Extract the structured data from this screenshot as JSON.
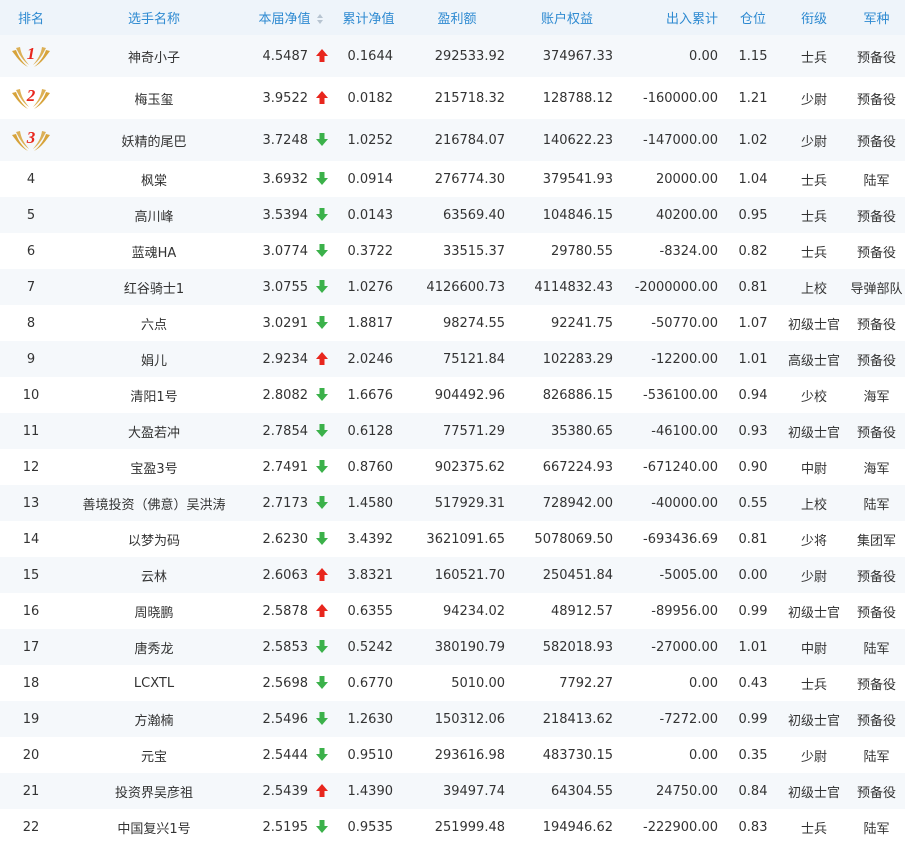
{
  "colors": {
    "header_text": "#2e8ad1",
    "header_bg": "#eef4fa",
    "up_arrow": "#e8261d",
    "down_arrow": "#3bb14a",
    "medal_number": "#e8261d",
    "medal_wing": "#d7a33a"
  },
  "headers": {
    "rank": "排名",
    "name": "选手名称",
    "nav": "本届净值",
    "cum": "累计净值",
    "profit": "盈利额",
    "equity": "账户权益",
    "flow": "出入累计",
    "position": "仓位",
    "military_rank": "衔级",
    "branch": "军种"
  },
  "rows": [
    {
      "rank": "1",
      "name": "神奇小子",
      "nav": "4.5487",
      "trend": "up",
      "cum": "0.1644",
      "profit": "292533.92",
      "equity": "374967.33",
      "flow": "0.00",
      "position": "1.15",
      "military_rank": "士兵",
      "branch": "预备役"
    },
    {
      "rank": "2",
      "name": "梅玉玺",
      "nav": "3.9522",
      "trend": "up",
      "cum": "0.0182",
      "profit": "215718.32",
      "equity": "128788.12",
      "flow": "-160000.00",
      "position": "1.21",
      "military_rank": "少尉",
      "branch": "预备役"
    },
    {
      "rank": "3",
      "name": "妖精的尾巴",
      "nav": "3.7248",
      "trend": "down",
      "cum": "1.0252",
      "profit": "216784.07",
      "equity": "140622.23",
      "flow": "-147000.00",
      "position": "1.02",
      "military_rank": "少尉",
      "branch": "预备役"
    },
    {
      "rank": "4",
      "name": "枫棠",
      "nav": "3.6932",
      "trend": "down",
      "cum": "0.0914",
      "profit": "276774.30",
      "equity": "379541.93",
      "flow": "20000.00",
      "position": "1.04",
      "military_rank": "士兵",
      "branch": "陆军"
    },
    {
      "rank": "5",
      "name": "高川峰",
      "nav": "3.5394",
      "trend": "down",
      "cum": "0.0143",
      "profit": "63569.40",
      "equity": "104846.15",
      "flow": "40200.00",
      "position": "0.95",
      "military_rank": "士兵",
      "branch": "预备役"
    },
    {
      "rank": "6",
      "name": "蓝魂HA",
      "nav": "3.0774",
      "trend": "down",
      "cum": "0.3722",
      "profit": "33515.37",
      "equity": "29780.55",
      "flow": "-8324.00",
      "position": "0.82",
      "military_rank": "士兵",
      "branch": "预备役"
    },
    {
      "rank": "7",
      "name": "红谷骑士1",
      "nav": "3.0755",
      "trend": "down",
      "cum": "1.0276",
      "profit": "4126600.73",
      "equity": "4114832.43",
      "flow": "-2000000.00",
      "position": "0.81",
      "military_rank": "上校",
      "branch": "导弹部队"
    },
    {
      "rank": "8",
      "name": "六点",
      "nav": "3.0291",
      "trend": "down",
      "cum": "1.8817",
      "profit": "98274.55",
      "equity": "92241.75",
      "flow": "-50770.00",
      "position": "1.07",
      "military_rank": "初级士官",
      "branch": "预备役"
    },
    {
      "rank": "9",
      "name": "娟儿",
      "nav": "2.9234",
      "trend": "up",
      "cum": "2.0246",
      "profit": "75121.84",
      "equity": "102283.29",
      "flow": "-12200.00",
      "position": "1.01",
      "military_rank": "高级士官",
      "branch": "预备役"
    },
    {
      "rank": "10",
      "name": "清阳1号",
      "nav": "2.8082",
      "trend": "down",
      "cum": "1.6676",
      "profit": "904492.96",
      "equity": "826886.15",
      "flow": "-536100.00",
      "position": "0.94",
      "military_rank": "少校",
      "branch": "海军"
    },
    {
      "rank": "11",
      "name": "大盈若冲",
      "nav": "2.7854",
      "trend": "down",
      "cum": "0.6128",
      "profit": "77571.29",
      "equity": "35380.65",
      "flow": "-46100.00",
      "position": "0.93",
      "military_rank": "初级士官",
      "branch": "预备役"
    },
    {
      "rank": "12",
      "name": "宝盈3号",
      "nav": "2.7491",
      "trend": "down",
      "cum": "0.8760",
      "profit": "902375.62",
      "equity": "667224.93",
      "flow": "-671240.00",
      "position": "0.90",
      "military_rank": "中尉",
      "branch": "海军"
    },
    {
      "rank": "13",
      "name": "善境投资（佛意）吴洪涛",
      "nav": "2.7173",
      "trend": "down",
      "cum": "1.4580",
      "profit": "517929.31",
      "equity": "728942.00",
      "flow": "-40000.00",
      "position": "0.55",
      "military_rank": "上校",
      "branch": "陆军"
    },
    {
      "rank": "14",
      "name": "以梦为码",
      "nav": "2.6230",
      "trend": "down",
      "cum": "3.4392",
      "profit": "3621091.65",
      "equity": "5078069.50",
      "flow": "-693436.69",
      "position": "0.81",
      "military_rank": "少将",
      "branch": "集团军"
    },
    {
      "rank": "15",
      "name": "云林",
      "nav": "2.6063",
      "trend": "up",
      "cum": "3.8321",
      "profit": "160521.70",
      "equity": "250451.84",
      "flow": "-5005.00",
      "position": "0.00",
      "military_rank": "少尉",
      "branch": "预备役"
    },
    {
      "rank": "16",
      "name": "周晓鹏",
      "nav": "2.5878",
      "trend": "up",
      "cum": "0.6355",
      "profit": "94234.02",
      "equity": "48912.57",
      "flow": "-89956.00",
      "position": "0.99",
      "military_rank": "初级士官",
      "branch": "预备役"
    },
    {
      "rank": "17",
      "name": "唐秀龙",
      "nav": "2.5853",
      "trend": "down",
      "cum": "0.5242",
      "profit": "380190.79",
      "equity": "582018.93",
      "flow": "-27000.00",
      "position": "1.01",
      "military_rank": "中尉",
      "branch": "陆军"
    },
    {
      "rank": "18",
      "name": "LCXTL",
      "nav": "2.5698",
      "trend": "down",
      "cum": "0.6770",
      "profit": "5010.00",
      "equity": "7792.27",
      "flow": "0.00",
      "position": "0.43",
      "military_rank": "士兵",
      "branch": "预备役"
    },
    {
      "rank": "19",
      "name": "方瀚楠",
      "nav": "2.5496",
      "trend": "down",
      "cum": "1.2630",
      "profit": "150312.06",
      "equity": "218413.62",
      "flow": "-7272.00",
      "position": "0.99",
      "military_rank": "初级士官",
      "branch": "预备役"
    },
    {
      "rank": "20",
      "name": "元宝",
      "nav": "2.5444",
      "trend": "down",
      "cum": "0.9510",
      "profit": "293616.98",
      "equity": "483730.15",
      "flow": "0.00",
      "position": "0.35",
      "military_rank": "少尉",
      "branch": "陆军"
    },
    {
      "rank": "21",
      "name": "投资界吴彦祖",
      "nav": "2.5439",
      "trend": "up",
      "cum": "1.4390",
      "profit": "39497.74",
      "equity": "64304.55",
      "flow": "24750.00",
      "position": "0.84",
      "military_rank": "初级士官",
      "branch": "预备役"
    },
    {
      "rank": "22",
      "name": "中国复兴1号",
      "nav": "2.5195",
      "trend": "down",
      "cum": "0.9535",
      "profit": "251999.48",
      "equity": "194946.62",
      "flow": "-222900.00",
      "position": "0.83",
      "military_rank": "士兵",
      "branch": "陆军"
    }
  ]
}
